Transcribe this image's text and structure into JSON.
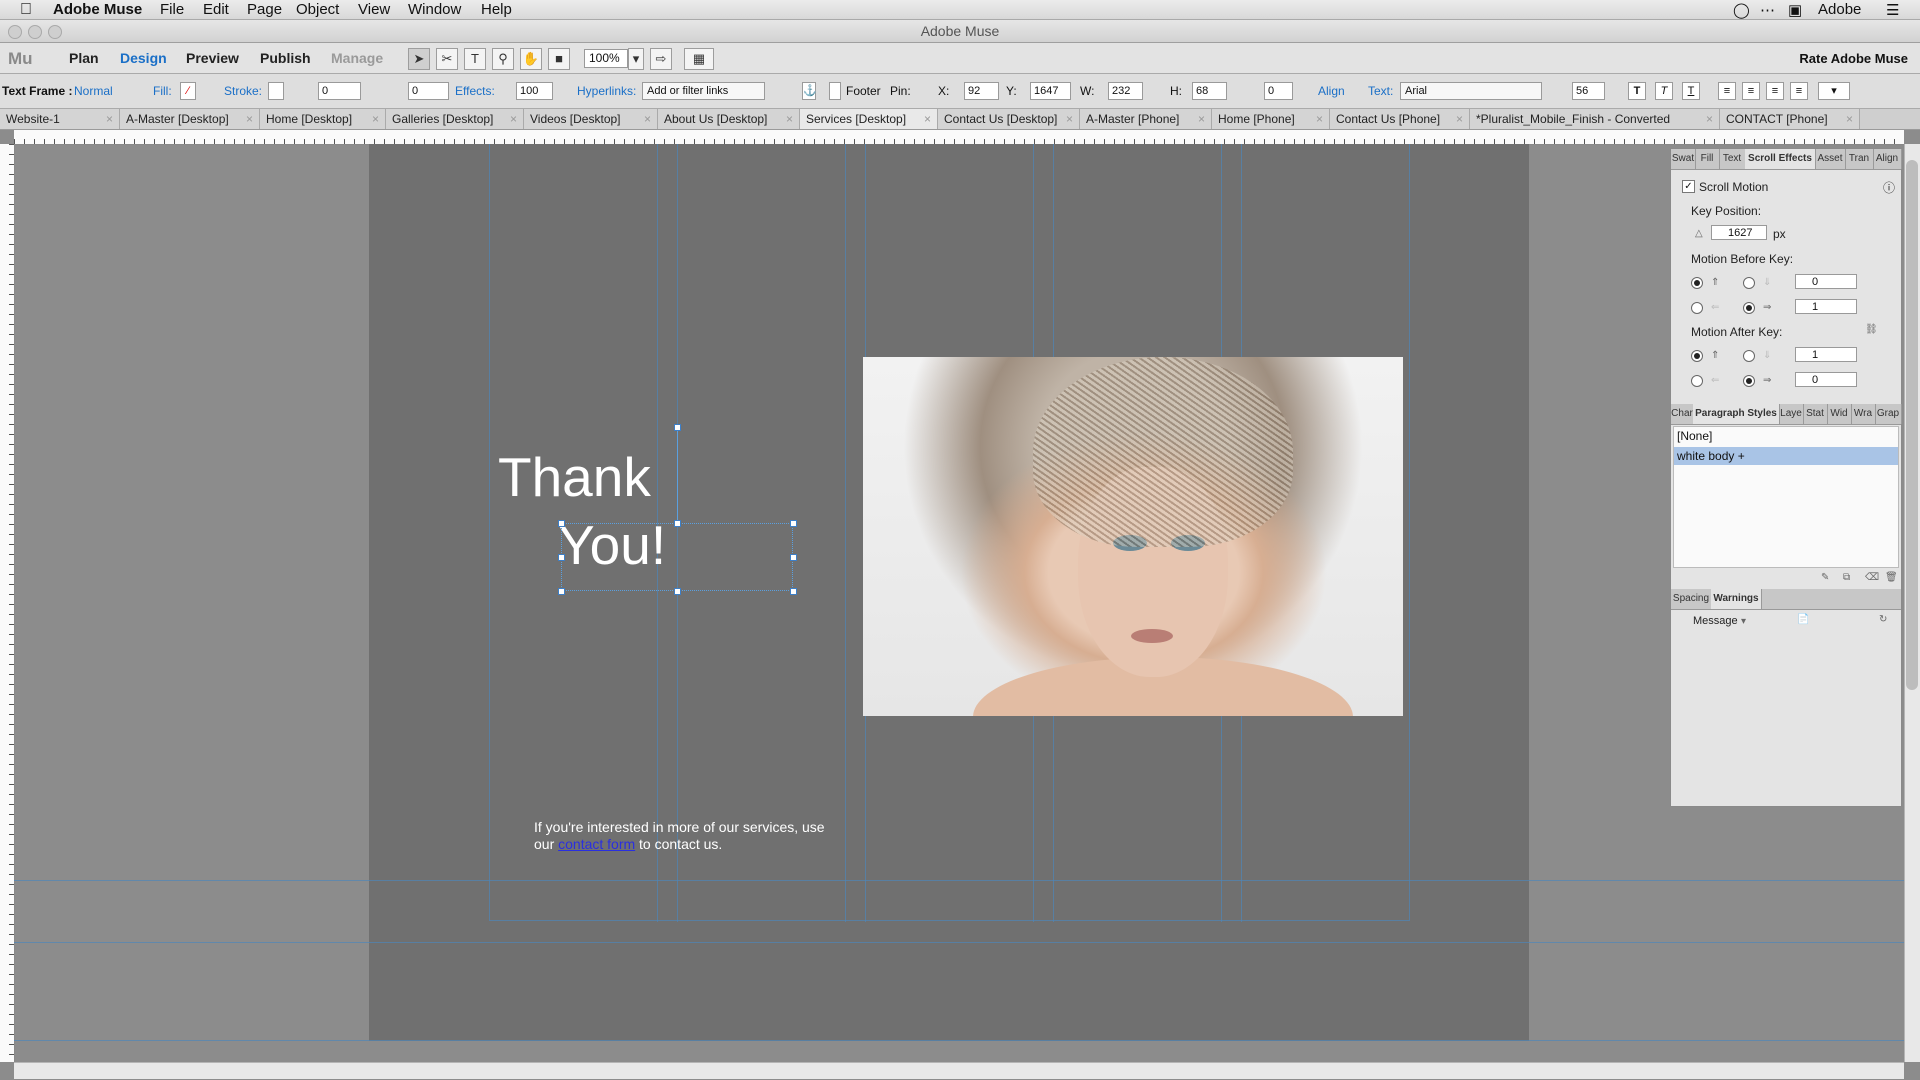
{
  "menubar": {
    "app_name": "Adobe Muse",
    "items": [
      "File",
      "Edit",
      "Page",
      "Object",
      "View",
      "Window",
      "Help"
    ],
    "right_label": "Adobe"
  },
  "window": {
    "title": "Adobe Muse"
  },
  "modebar": {
    "logo": "Mu",
    "modes": [
      "Plan",
      "Design",
      "Preview",
      "Publish",
      "Manage"
    ],
    "zoom": "100%",
    "rate_label": "Rate Adobe Muse"
  },
  "controlbar": {
    "frame_label": "Text Frame :",
    "frame_state": "Normal",
    "fill_label": "Fill:",
    "stroke_label": "Stroke:",
    "stroke_value": "0",
    "corner_value": "0",
    "effects_label": "Effects:",
    "effects_value": "100",
    "hyperlinks_label": "Hyperlinks:",
    "hyperlinks_placeholder": "Add or filter links",
    "footer_label": "Footer",
    "pin_label": "Pin:",
    "x_label": "X:",
    "x_value": "92",
    "y_label": "Y:",
    "y_value": "1647",
    "w_label": "W:",
    "w_value": "232",
    "h_label": "H:",
    "h_value": "68",
    "rotate_value": "0",
    "align_label": "Align",
    "text_label": "Text:",
    "font": "Arial",
    "font_size": "56"
  },
  "tabs": [
    "Website-1",
    "A-Master [Desktop]",
    "Home [Desktop]",
    "Galleries [Desktop]",
    "Videos [Desktop]",
    "About Us [Desktop]",
    "Services [Desktop]",
    "Contact Us [Desktop]",
    "A-Master [Phone]",
    "Home [Phone]",
    "Contact Us [Phone]",
    "*Pluralist_Mobile_Finish - Converted",
    "CONTACT [Phone]"
  ],
  "canvas": {
    "heading_line1": "Thank",
    "heading_line2": "You!",
    "body_before": "If you're interested in more of our services, use our ",
    "body_link": "contact form",
    "body_after": " to contact us."
  },
  "panel": {
    "tabs": [
      "Swat",
      "Fill",
      "Text",
      "Scroll Effects",
      "Asset",
      "Tran",
      "Align"
    ],
    "scroll_motion_label": "Scroll Motion",
    "key_position_label": "Key Position:",
    "key_position_value": "1627",
    "key_position_unit": "px",
    "motion_before_label": "Motion Before Key:",
    "before_v": "0",
    "before_h": "1",
    "motion_after_label": "Motion After Key:",
    "after_v": "1",
    "after_h": "0",
    "styles_tabs": [
      "Char",
      "Paragraph Styles",
      "Laye",
      "Stat",
      "Wid",
      "Wra",
      "Grap"
    ],
    "styles": [
      "[None]",
      "white body +"
    ],
    "bottom_tabs": [
      "Spacing",
      "Warnings"
    ],
    "message_label": "Message"
  },
  "colors": {
    "accent": "#1a6fc7",
    "guide": "#4f86b8",
    "page_bg": "#707070",
    "selected_style": "#a9c4e6"
  }
}
